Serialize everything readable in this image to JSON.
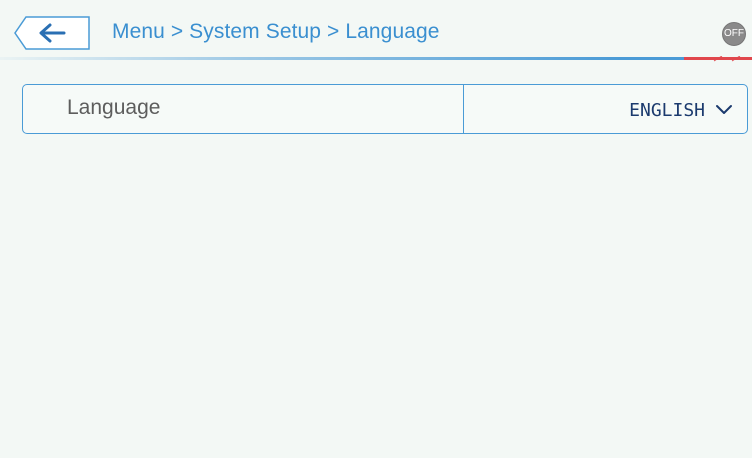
{
  "header": {
    "breadcrumb": "Menu > System Setup > Language",
    "power_badge": "OFF"
  },
  "icons": {
    "back": "arrow-left-icon",
    "dropdown": "chevron-down-icon"
  },
  "setting": {
    "label": "Language",
    "selected_value": "ENGLISH"
  },
  "colors": {
    "accent": "#3a8fd0",
    "border": "#4a9bd6",
    "background": "#f3f8f5",
    "highlight": "#e0474c"
  }
}
